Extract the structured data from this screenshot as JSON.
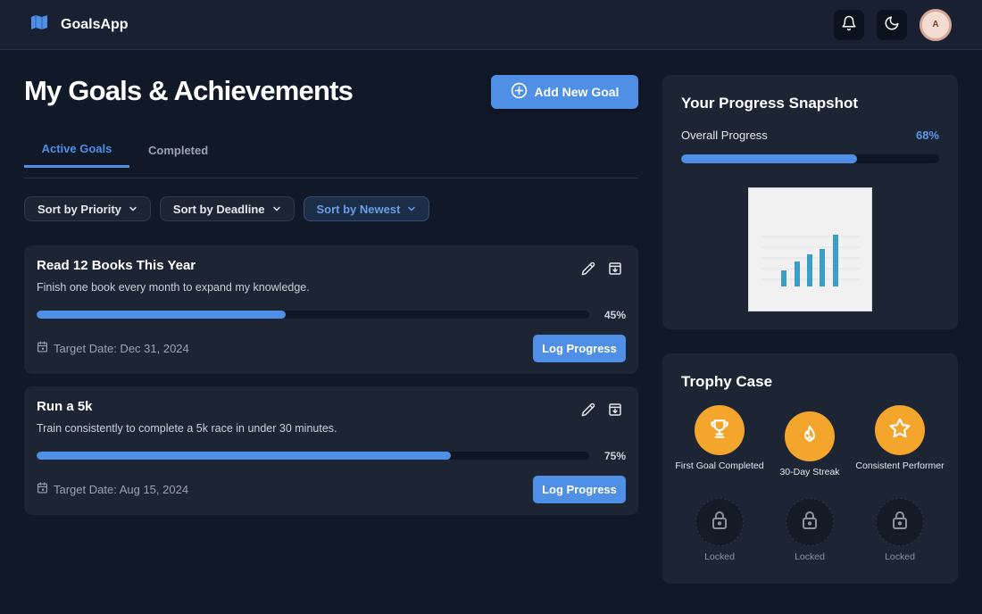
{
  "app": {
    "title": "GoalsApp",
    "avatar_initial": "A"
  },
  "icons": {
    "logo": "map-icon",
    "notifications": "bell-icon",
    "theme": "moon-icon",
    "add": "plus-circle-icon",
    "edit": "pencil-icon",
    "archive": "archive-icon",
    "calendar": "calendar-icon",
    "chevron": "chevron-down-icon"
  },
  "colors": {
    "accent": "#4f8fe6",
    "trophy": "#f4a52b",
    "background": "#111827",
    "card": "#1d2535"
  },
  "main": {
    "title": "My Goals & Achievements",
    "add_button_label": "Add New Goal",
    "tabs": [
      {
        "label": "Active Goals",
        "active": true
      },
      {
        "label": "Completed",
        "active": false
      }
    ],
    "sort_options": [
      {
        "label": "Sort by Priority",
        "active": false
      },
      {
        "label": "Sort by Deadline",
        "active": false
      },
      {
        "label": "Sort by Newest",
        "active": true
      }
    ],
    "goals": [
      {
        "title": "Read 12 Books This Year",
        "description": "Finish one book every month to expand my knowledge.",
        "progress": 45,
        "progress_label": "45%",
        "target_date": "Target Date: Dec 31, 2024",
        "log_button_label": "Log Progress"
      },
      {
        "title": "Run a 5k",
        "description": "Train consistently to complete a 5k race in under 30 minutes.",
        "progress": 75,
        "progress_label": "75%",
        "target_date": "Target Date: Aug 15, 2024",
        "log_button_label": "Log Progress"
      }
    ]
  },
  "snapshot": {
    "title": "Your Progress Snapshot",
    "overall_label": "Overall Progress",
    "overall_progress": 68,
    "overall_progress_label": "68%",
    "image_icon": "bar-chart-icon"
  },
  "trophies": {
    "title": "Trophy Case",
    "items": [
      {
        "label": "First Goal Completed",
        "icon": "trophy-icon",
        "locked": false
      },
      {
        "label": "30-Day Streak",
        "icon": "flame-icon",
        "locked": false
      },
      {
        "label": "Consistent Performer",
        "icon": "star-icon",
        "locked": false
      },
      {
        "label": "Locked",
        "icon": "lock-icon",
        "locked": true
      },
      {
        "label": "Locked",
        "icon": "lock-icon",
        "locked": true
      },
      {
        "label": "Locked",
        "icon": "lock-icon",
        "locked": true
      }
    ]
  }
}
